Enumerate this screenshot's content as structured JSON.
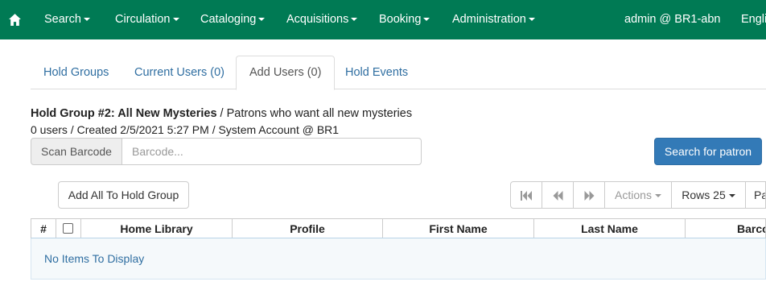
{
  "navbar": {
    "items": [
      {
        "label": "Search",
        "dropdown": true
      },
      {
        "label": "Circulation",
        "dropdown": true
      },
      {
        "label": "Cataloging",
        "dropdown": true
      },
      {
        "label": "Acquisitions",
        "dropdown": true
      },
      {
        "label": "Booking",
        "dropdown": true
      },
      {
        "label": "Administration",
        "dropdown": true
      }
    ],
    "user": "admin @ BR1-abn",
    "language": "English",
    "color": "#007a54"
  },
  "tabs": [
    {
      "label": "Hold Groups",
      "active": false
    },
    {
      "label": "Current Users (0)",
      "active": false
    },
    {
      "label": "Add Users (0)",
      "active": true
    },
    {
      "label": "Hold Events",
      "active": false
    }
  ],
  "group": {
    "title": "Hold Group #2: All New Mysteries",
    "description": " / Patrons who want all new mysteries",
    "meta": "0 users / Created 2/5/2021 5:27 PM / System Account @ BR1"
  },
  "scan": {
    "addon_label": "Scan Barcode",
    "placeholder": "Barcode...",
    "value": ""
  },
  "search_button": "Search for patron",
  "add_all_button": "Add All To Hold Group",
  "pager": {
    "first_icon": "first-page-icon",
    "prev_icon": "previous-page-icon",
    "next_icon": "next-page-icon",
    "actions_label": "Actions",
    "rows_label": "Rows 25",
    "page_label": "Page"
  },
  "grid": {
    "columns": [
      "#",
      "",
      "Home Library",
      "Profile",
      "First Name",
      "Last Name",
      "Barcode"
    ],
    "empty_message": "No Items To Display"
  },
  "colors": {
    "primary": "#337ab7",
    "link": "#2f6ea1"
  }
}
